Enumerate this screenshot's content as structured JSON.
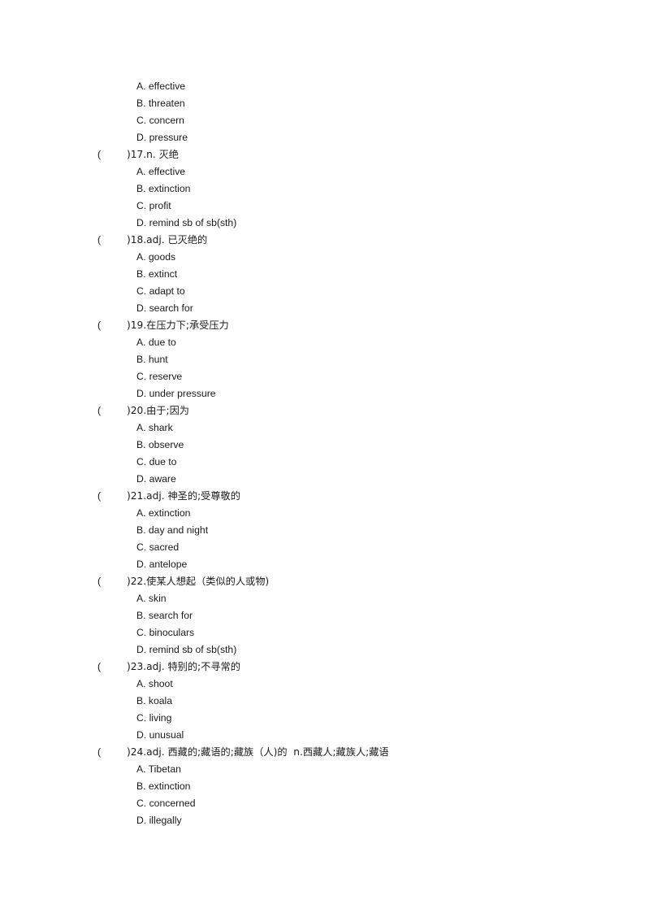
{
  "document": {
    "type": "vocabulary-multiple-choice-worksheet",
    "paren_open": "(",
    "paren_close": ")"
  },
  "continued_options": [
    "A. effective",
    "B. threaten",
    "C. concern",
    "D. pressure"
  ],
  "questions": [
    {
      "number": "17",
      "stem": ")17.n. 灭绝",
      "options": [
        "A. effective",
        "B. extinction",
        "C. profit",
        "D. remind sb of sb(sth)"
      ]
    },
    {
      "number": "18",
      "stem": ")18.adj. 已灭绝的",
      "options": [
        "A. goods",
        "B. extinct",
        "C. adapt to",
        "D. search for"
      ]
    },
    {
      "number": "19",
      "stem": ")19.在压力下;承受压力",
      "options": [
        "A. due to",
        "B. hunt",
        "C. reserve",
        "D. under pressure"
      ]
    },
    {
      "number": "20",
      "stem": ")20.由于;因为",
      "options": [
        "A. shark",
        "B. observe",
        "C. due to",
        "D. aware"
      ]
    },
    {
      "number": "21",
      "stem": ")21.adj. 神圣的;受尊敬的",
      "options": [
        "A. extinction",
        "B. day and night",
        "C. sacred",
        "D. antelope"
      ]
    },
    {
      "number": "22",
      "stem": ")22.使某人想起（类似的人或物)",
      "options": [
        "A. skin",
        "B. search for",
        "C. binoculars",
        "D. remind sb of sb(sth)"
      ]
    },
    {
      "number": "23",
      "stem": ")23.adj. 特别的;不寻常的",
      "options": [
        "A. shoot",
        "B. koala",
        "C. living",
        "D. unusual"
      ]
    },
    {
      "number": "24",
      "stem": ")24.adj. 西藏的;藏语的;藏族（人)的  n.西藏人;藏族人;藏语",
      "options": [
        "A. Tibetan",
        "B. extinction",
        "C. concerned",
        "D. illegally"
      ]
    }
  ]
}
